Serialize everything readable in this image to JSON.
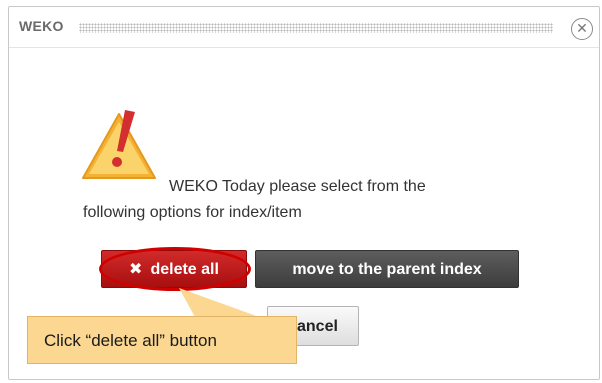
{
  "dialog": {
    "title": "WEKO",
    "close_symbol": "✕",
    "icons": {
      "close": "close-icon",
      "warning": "warning-icon",
      "delete": "x-icon"
    },
    "message_line1": "WEKO Today please select from the",
    "message_line2": "following options for index/item"
  },
  "buttons": {
    "delete_all": "delete all",
    "delete_icon_glyph": "✖",
    "move_to_parent": "move to the parent index",
    "cancel": "cancel"
  },
  "annotation": {
    "callout_text": "Click “delete all” button"
  },
  "colors": {
    "delete_button": "#b71c1c",
    "move_button": "#4a4a4a",
    "cancel_button": "#e6e6e6",
    "warning_icon": "#f5a623",
    "exclamation": "#d32f2f",
    "highlight_ring": "#d10000",
    "callout_fill": "#fbd791"
  }
}
